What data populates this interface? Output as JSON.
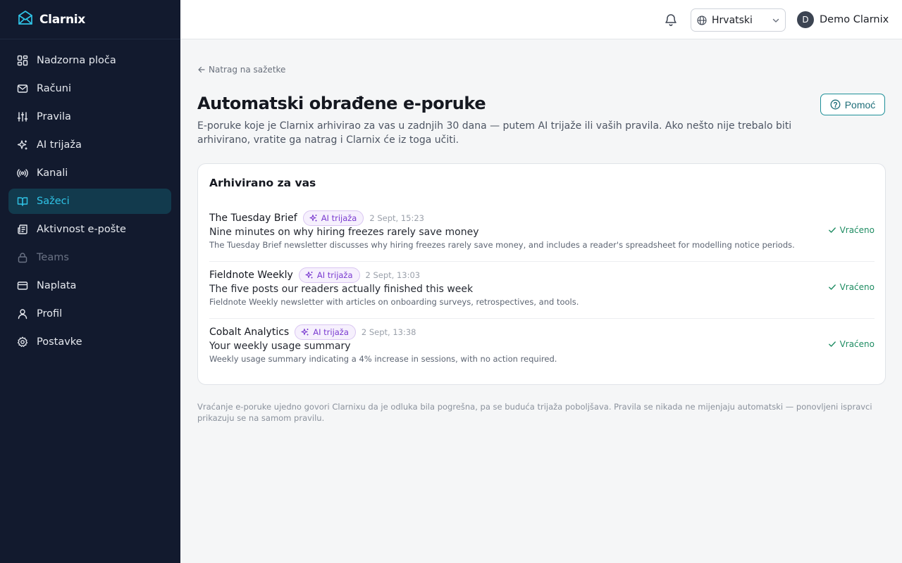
{
  "app": {
    "name": "Clarnix"
  },
  "colors": {
    "sidebar_bg": "#121a2e",
    "accent": "#2fc3e6",
    "success": "#1e8c62",
    "ai_badge": "#7a3bd0"
  },
  "sidebar": {
    "items": [
      {
        "label": "Nadzorna ploča",
        "icon": "dashboard-icon"
      },
      {
        "label": "Računi",
        "icon": "mail-icon"
      },
      {
        "label": "Pravila",
        "icon": "sliders-icon"
      },
      {
        "label": "AI trijaža",
        "icon": "sparkles-icon"
      },
      {
        "label": "Kanali",
        "icon": "radio-icon"
      },
      {
        "label": "Sažeci",
        "icon": "book-open-icon",
        "active": true
      },
      {
        "label": "Aktivnost e-pošte",
        "icon": "newspaper-icon"
      },
      {
        "label": "Teams",
        "icon": "lock-icon",
        "disabled": true
      },
      {
        "label": "Naplata",
        "icon": "credit-card-icon"
      },
      {
        "label": "Profil",
        "icon": "user-icon"
      },
      {
        "label": "Postavke",
        "icon": "gear-icon"
      }
    ]
  },
  "header": {
    "language": "Hrvatski",
    "user": {
      "initial": "D",
      "name": "Demo Clarnix"
    }
  },
  "main": {
    "back_link": "Natrag na sažetke",
    "title": "Automatski obrađene e-poruke",
    "subtitle": "E-poruke koje je Clarnix arhivirao za vas u zadnjih 30 dana — putem AI trijaže ili vaših pravila. Ako nešto nije trebalo biti arhivirano, vratite ga natrag i Clarnix će iz toga učiti.",
    "help_label": "Pomoć",
    "card": {
      "title": "Arhivirano za vas",
      "rows": [
        {
          "sender": "The Tuesday Brief",
          "badge": "AI trijaža",
          "time": "2 Sept, 15:23",
          "subject": "Nine minutes on why hiring freezes rarely save money",
          "summary": "The Tuesday Brief newsletter discusses why hiring freezes rarely save money, and includes a reader's spreadsheet for modelling notice periods.",
          "status": "Vraćeno"
        },
        {
          "sender": "Fieldnote Weekly",
          "badge": "AI trijaža",
          "time": "2 Sept, 13:03",
          "subject": "The five posts our readers actually finished this week",
          "summary": "Fieldnote Weekly newsletter with articles on onboarding surveys, retrospectives, and tools.",
          "status": "Vraćeno"
        },
        {
          "sender": "Cobalt Analytics",
          "badge": "AI trijaža",
          "time": "2 Sept, 13:38",
          "subject": "Your weekly usage summary",
          "summary": "Weekly usage summary indicating a 4% increase in sessions, with no action required.",
          "status": "Vraćeno"
        }
      ]
    },
    "footnote": "Vraćanje e-poruke ujedno govori Clarnixu da je odluka bila pogrešna, pa se buduća trijaža poboljšava. Pravila se nikada ne mijenjaju automatski — ponovljeni ispravci prikazuju se na samom pravilu."
  }
}
